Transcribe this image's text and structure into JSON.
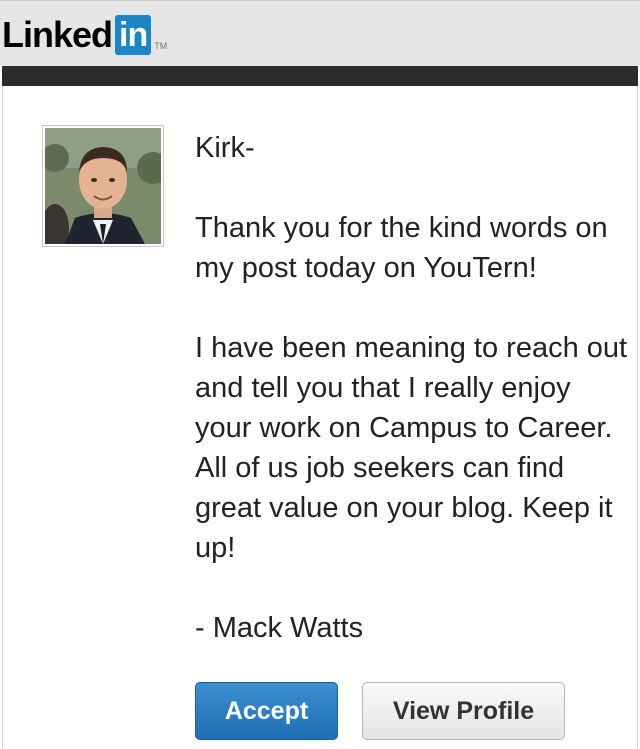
{
  "header": {
    "logo_text": "Linked",
    "logo_in": "in",
    "logo_tm": "TM"
  },
  "message": {
    "greeting": "Kirk-",
    "paragraph1": "Thank you for the kind words on my post today on YouTern!",
    "paragraph2": "I have been meaning to reach out and tell you that I really enjoy your work on Campus to Career. All of us job seekers can find great value on your blog. Keep it up!",
    "signature": "- Mack Watts"
  },
  "actions": {
    "accept_label": "Accept",
    "view_profile_label": "View Profile"
  },
  "colors": {
    "brand_blue": "#1b86c5",
    "accept_button": "#1e6fb4",
    "header_bg": "#e6e6e6",
    "dark_bar": "#2b2b2b"
  }
}
